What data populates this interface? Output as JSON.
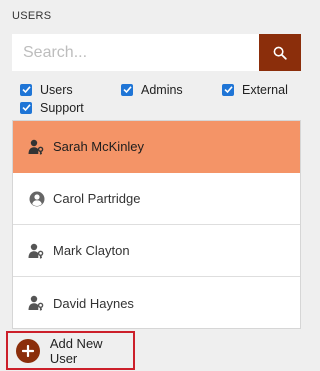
{
  "panel": {
    "title": "USERS"
  },
  "search": {
    "placeholder": "Search...",
    "icon": "search-icon"
  },
  "filters": [
    {
      "label": "Users",
      "checked": true
    },
    {
      "label": "Admins",
      "checked": true
    },
    {
      "label": "External",
      "checked": true
    },
    {
      "label": "Support",
      "checked": true
    }
  ],
  "users": [
    {
      "name": "Sarah McKinley",
      "icon": "user-key-icon",
      "selected": true
    },
    {
      "name": "Carol Partridge",
      "icon": "user-circle-icon",
      "selected": false
    },
    {
      "name": "Mark Clayton",
      "icon": "user-key-icon",
      "selected": false
    },
    {
      "name": "David Haynes",
      "icon": "user-key-icon",
      "selected": false
    }
  ],
  "add_button": {
    "label": "Add New User",
    "icon": "plus-circle-icon"
  },
  "colors": {
    "accent": "#8b2e0b",
    "selected_row": "#f49467",
    "checkbox": "#1f75d6",
    "highlight_border": "#cc1f2a"
  }
}
